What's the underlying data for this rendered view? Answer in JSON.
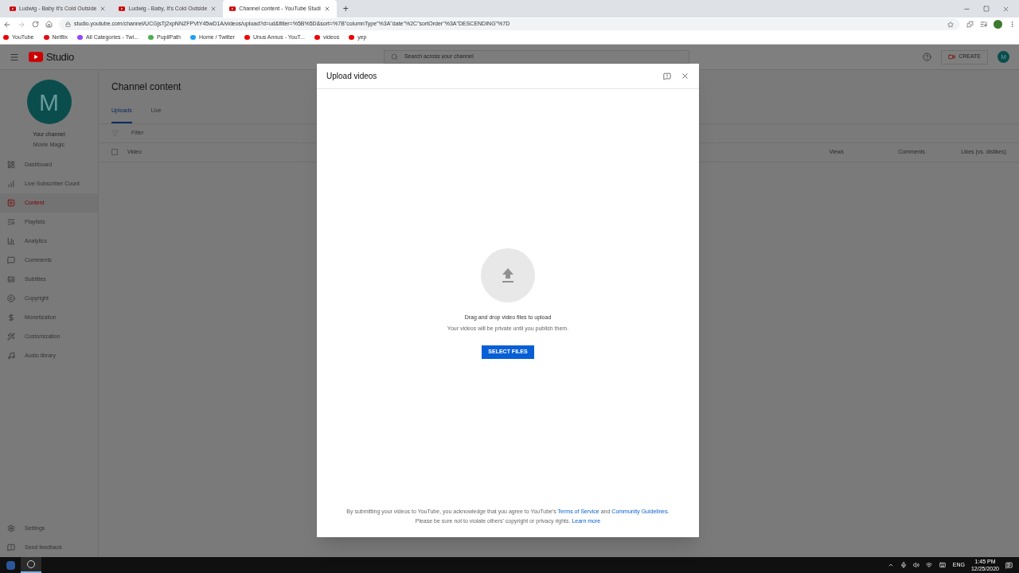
{
  "browser": {
    "tabs": [
      {
        "title": "Ludwig - Baby It's Cold Outside",
        "selected": false
      },
      {
        "title": "Ludwig - Baby, It's Cold Outside",
        "selected": false
      },
      {
        "title": "Channel content - YouTube Studi",
        "selected": true
      }
    ],
    "new_tab": "+",
    "address": "studio.youtube.com/channel/UCGjsTj2xpNNZFPVtY45wD1A/videos/upload?d=ud&filter=%5B%5D&sort=%7B\"columnType\"%3A\"date\"%2C\"sortOrder\"%3A\"DESCENDING\"%7D",
    "bookmarks": [
      "YouTube",
      "Netflix",
      "All Categories - Twi...",
      "PupilPath",
      "Home / Twitter",
      "Unus Annus - YouT...",
      "videos",
      "yep"
    ]
  },
  "studio": {
    "logo": "Studio",
    "search": {
      "placeholder": "Search across your channel"
    },
    "create": "CREATE",
    "avatar": "M",
    "channel": {
      "avatar": "M",
      "label": "Your channel",
      "name": "Movie Magic"
    },
    "nav": [
      {
        "label": "Dashboard",
        "selected": false
      },
      {
        "label": "Live Subscriber Count",
        "selected": false
      },
      {
        "label": "Content",
        "selected": true
      },
      {
        "label": "Playlists",
        "selected": false
      },
      {
        "label": "Analytics",
        "selected": false
      },
      {
        "label": "Comments",
        "selected": false
      },
      {
        "label": "Subtitles",
        "selected": false
      },
      {
        "label": "Copyright",
        "selected": false
      },
      {
        "label": "Monetization",
        "selected": false
      },
      {
        "label": "Customization",
        "selected": false
      },
      {
        "label": "Audio library",
        "selected": false
      }
    ],
    "nav_bottom": [
      "Settings",
      "Send feedback"
    ],
    "page_title": "Channel content",
    "tabs": [
      {
        "label": "Uploads",
        "selected": true
      },
      {
        "label": "Live",
        "selected": false
      }
    ],
    "filter": {
      "placeholder": "Filter"
    },
    "select_all": {
      "checked": false
    },
    "columns": [
      "Video",
      "Views",
      "Comments",
      "Likes (vs. dislikes)"
    ]
  },
  "dialog": {
    "title": "Upload videos",
    "prompt": "Drag and drop video files to upload",
    "note": "Your videos will be private until you publish them.",
    "button": "SELECT FILES",
    "legal_1": "By submitting your videos to YouTube, you acknowledge that you agree to YouTube's",
    "terms": "Terms of Service",
    "and": "and",
    "guidelines": "Community Guidelines",
    "period": ".",
    "legal_2": "Please be sure not to violate others' copyright or privacy rights.",
    "learn_more": "Learn more"
  },
  "taskbar": {
    "language": "ENG",
    "time": "1:45 PM",
    "date": "12/25/2020"
  }
}
